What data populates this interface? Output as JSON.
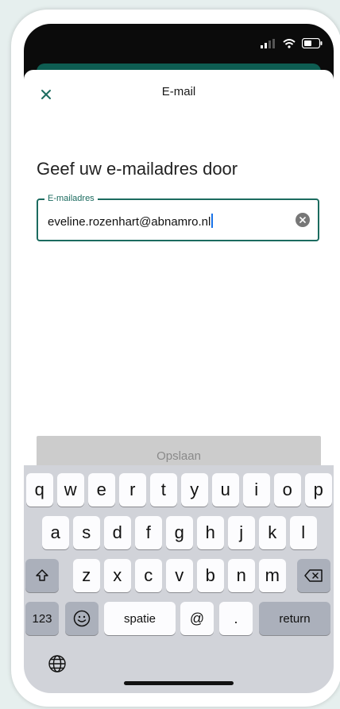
{
  "header": {
    "title": "E-mail"
  },
  "page": {
    "heading": "Geef uw e-mailadres door",
    "email_field": {
      "label": "E-mailadres",
      "value": "eveline.rozenhart@abnamro.nl"
    },
    "save_label": "Opslaan"
  },
  "keyboard": {
    "row1": [
      "q",
      "w",
      "e",
      "r",
      "t",
      "y",
      "u",
      "i",
      "o",
      "p"
    ],
    "row2": [
      "a",
      "s",
      "d",
      "f",
      "g",
      "h",
      "j",
      "k",
      "l"
    ],
    "row3": [
      "z",
      "x",
      "c",
      "v",
      "b",
      "n",
      "m"
    ],
    "numbers_label": "123",
    "space_label": "spatie",
    "at_label": "@",
    "dot_label": ".",
    "return_label": "return"
  },
  "colors": {
    "accent": "#1b6b5f",
    "app_bar": "#0e5d52",
    "disabled_button": "#cccccc",
    "keyboard_bg": "#d1d3d9"
  },
  "icons": [
    "signal-icon",
    "wifi-icon",
    "battery-icon",
    "close-icon",
    "clear-icon",
    "shift-icon",
    "delete-icon",
    "emoji-icon",
    "globe-icon"
  ]
}
